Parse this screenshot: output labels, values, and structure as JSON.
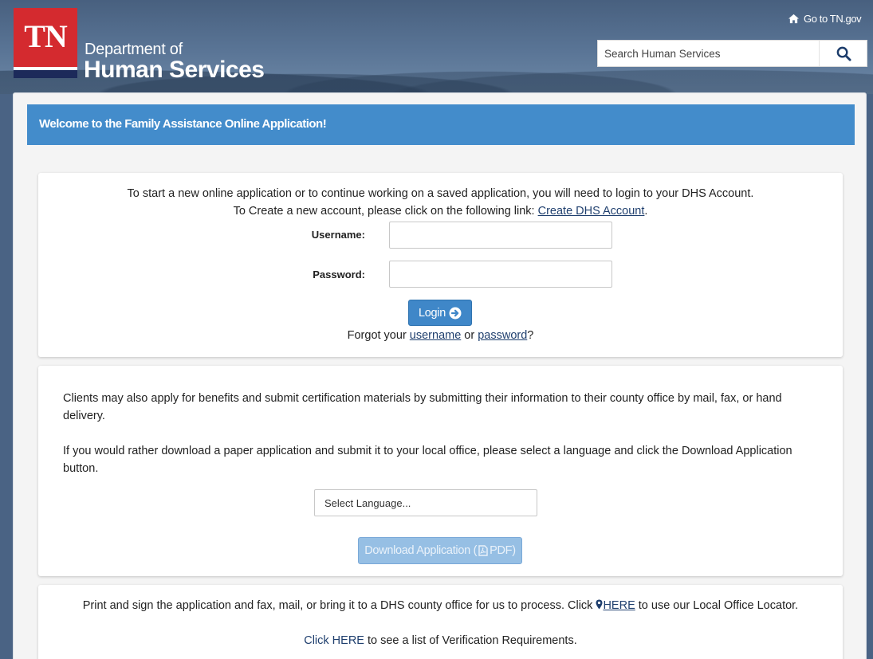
{
  "header": {
    "logo_text": "TN",
    "dept_line1": "Department of",
    "dept_line2": "Human Services",
    "goto_label": "Go to TN.gov",
    "search_placeholder": "Search Human Services"
  },
  "welcome_banner": "Welcome to the Family Assistance Online Application!",
  "login_card": {
    "intro_line1": "To start a new online application or to continue working on a saved application, you will need to login to your DHS Account.",
    "intro_line2_prefix": "To Create a new account, please click on the following link: ",
    "create_account_link": "Create DHS Account",
    "intro_line2_suffix": ".",
    "username_label": "Username:",
    "password_label": "Password:",
    "login_button": "Login",
    "forgot_prefix": "Forgot your ",
    "forgot_username_link": "username",
    "forgot_or": " or ",
    "forgot_password_link": "password",
    "forgot_suffix": "?"
  },
  "paper_card": {
    "para1": "Clients may also apply for benefits and submit certification materials by submitting their information to their county office by mail, fax, or hand delivery.",
    "para2": "If you would rather download a paper application and submit it to your local office, please select a language and click the Download Application button.",
    "language_select": "Select Language...",
    "download_button": "Download Application (",
    "download_button_pdf": "PDF)"
  },
  "office_card": {
    "print_prefix": "Print and sign the application and fax, mail, or bring it to a DHS county office for us to process. Click ",
    "here_link": "HERE",
    "print_suffix": " to use our Local Office Locator.",
    "verification_link": "Click HERE",
    "verification_suffix": " to see a list of Verification Requirements."
  },
  "colors": {
    "banner_blue": "#438ccb",
    "login_button_blue": "#3f87c8",
    "logo_red": "#d42a2f",
    "link_navy": "#1f3f6e"
  },
  "icons": [
    "home-icon",
    "search-icon",
    "arrow-circle-right-icon",
    "pdf-file-icon",
    "map-pin-icon"
  ]
}
